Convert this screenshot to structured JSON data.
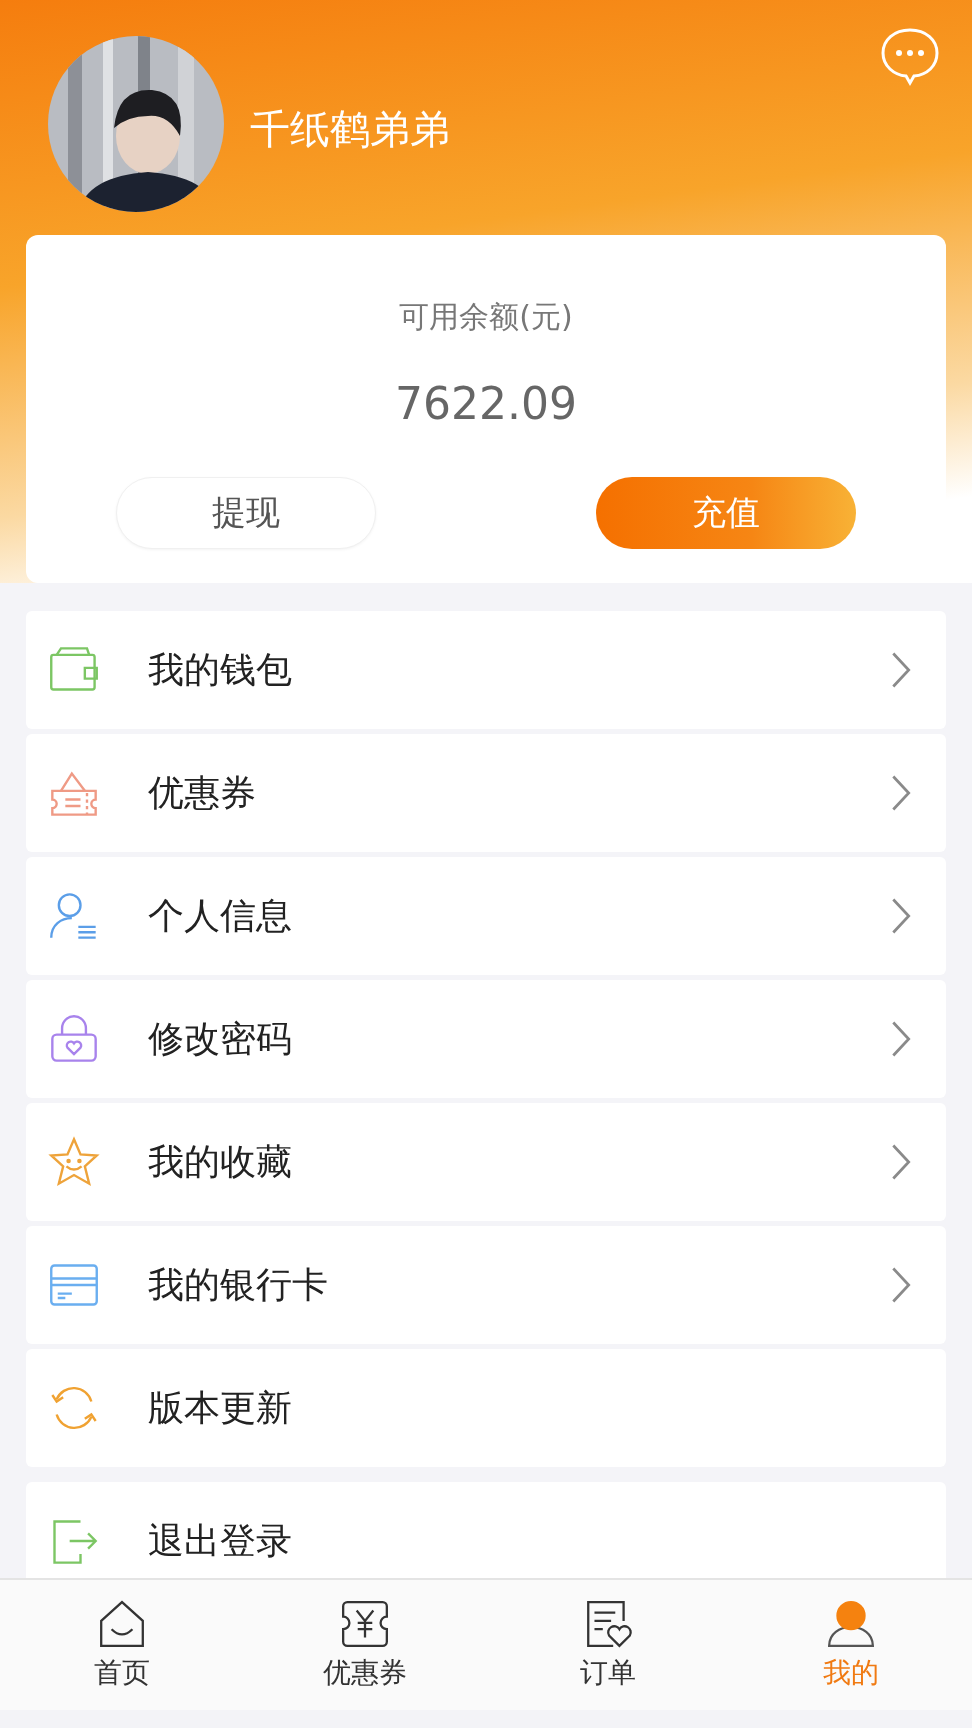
{
  "profile": {
    "name": "千纸鹤弟弟"
  },
  "balance": {
    "label": "可用余额(元)",
    "amount": "7622.09",
    "buttons": [
      {
        "label": "提现",
        "kind": "plain"
      },
      {
        "label": "充值",
        "kind": "primary"
      }
    ]
  },
  "menu": [
    {
      "label": "我的钱包",
      "kind": "wallet",
      "arrow": true
    },
    {
      "label": "优惠券",
      "kind": "coupon",
      "arrow": true
    },
    {
      "label": "个人信息",
      "kind": "person",
      "arrow": true
    },
    {
      "label": "修改密码",
      "kind": "lock",
      "arrow": true
    },
    {
      "label": "我的收藏",
      "kind": "star",
      "arrow": true
    },
    {
      "label": "我的银行卡",
      "kind": "card",
      "arrow": true
    },
    {
      "label": "版本更新",
      "kind": "refresh",
      "arrow": false
    },
    {
      "label": "退出登录",
      "kind": "exit",
      "arrow": false
    }
  ],
  "tabs": [
    {
      "label": "首页",
      "kind": "home",
      "selected": false
    },
    {
      "label": "优惠券",
      "kind": "coupon",
      "selected": false
    },
    {
      "label": "订单",
      "kind": "order",
      "selected": false
    },
    {
      "label": "我的",
      "kind": "user",
      "selected": true
    }
  ]
}
